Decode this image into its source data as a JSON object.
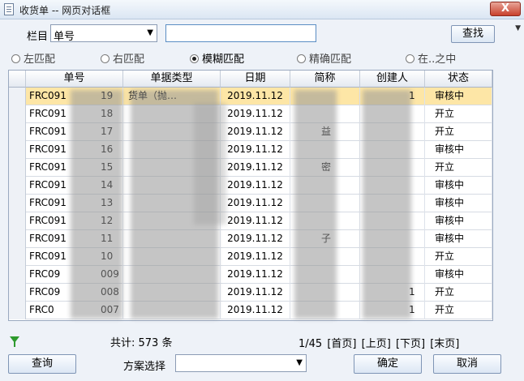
{
  "window": {
    "title": "收货单 -- 网页对话框",
    "close_glyph": "X"
  },
  "search": {
    "field_label": "栏目",
    "field_value": "单号",
    "query": "",
    "button": "查找"
  },
  "match_modes": [
    {
      "label": "左匹配",
      "selected": false
    },
    {
      "label": "右匹配",
      "selected": false
    },
    {
      "label": "模糊匹配",
      "selected": true
    },
    {
      "label": "精确匹配",
      "selected": false
    },
    {
      "label": "在..之中",
      "selected": false
    }
  ],
  "table": {
    "columns": [
      "单号",
      "单据类型",
      "日期",
      "简称",
      "创建人",
      "状态"
    ],
    "rows": [
      {
        "no_prefix": "FRC091",
        "no_suffix": "19",
        "type": "货单（抛…",
        "date": "2019.11.12",
        "short": "",
        "creator": "1",
        "status": "审核中",
        "selected": true
      },
      {
        "no_prefix": "FRC091",
        "no_suffix": "18",
        "type": "",
        "date": "2019.11.12",
        "short": "",
        "creator": "",
        "status": "开立",
        "selected": false
      },
      {
        "no_prefix": "FRC091",
        "no_suffix": "17",
        "type": "",
        "date": "2019.11.12",
        "short": "益",
        "creator": "",
        "status": "开立",
        "selected": false
      },
      {
        "no_prefix": "FRC091",
        "no_suffix": "16",
        "type": "",
        "date": "2019.11.12",
        "short": "",
        "creator": "",
        "status": "审核中",
        "selected": false
      },
      {
        "no_prefix": "FRC091",
        "no_suffix": "15",
        "type": "",
        "date": "2019.11.12",
        "short": "密",
        "creator": "",
        "status": "开立",
        "selected": false
      },
      {
        "no_prefix": "FRC091",
        "no_suffix": "14",
        "type": "",
        "date": "2019.11.12",
        "short": "",
        "creator": "",
        "status": "审核中",
        "selected": false
      },
      {
        "no_prefix": "FRC091",
        "no_suffix": "13",
        "type": "",
        "date": "2019.11.12",
        "short": "",
        "creator": "",
        "status": "审核中",
        "selected": false
      },
      {
        "no_prefix": "FRC091",
        "no_suffix": "12",
        "type": "",
        "date": "2019.11.12",
        "short": "",
        "creator": "",
        "status": "审核中",
        "selected": false
      },
      {
        "no_prefix": "FRC091",
        "no_suffix": "11",
        "type": "",
        "date": "2019.11.12",
        "short": "子",
        "creator": "",
        "status": "审核中",
        "selected": false
      },
      {
        "no_prefix": "FRC091",
        "no_suffix": "10",
        "type": "",
        "date": "2019.11.12",
        "short": "",
        "creator": "",
        "status": "开立",
        "selected": false
      },
      {
        "no_prefix": "FRC09",
        "no_suffix": "009",
        "type": "",
        "date": "2019.11.12",
        "short": "",
        "creator": "",
        "status": "审核中",
        "selected": false
      },
      {
        "no_prefix": "FRC09",
        "no_suffix": "008",
        "type": "",
        "date": "2019.11.12",
        "short": "",
        "creator": "1",
        "status": "开立",
        "selected": false
      },
      {
        "no_prefix": "FRC0",
        "no_suffix": "007",
        "type": "",
        "date": "2019.11.12",
        "short": "",
        "creator": "1",
        "status": "开立",
        "selected": false
      }
    ]
  },
  "footer": {
    "total": "共计: 573 条",
    "page": "1/45",
    "first": "[首页]",
    "prev": "[上页]",
    "next": "[下页]",
    "last": "[末页]"
  },
  "bottom": {
    "query_button": "查询",
    "plan_label": "方案选择",
    "plan_value": "",
    "ok_button": "确定",
    "cancel_button": "取消"
  }
}
